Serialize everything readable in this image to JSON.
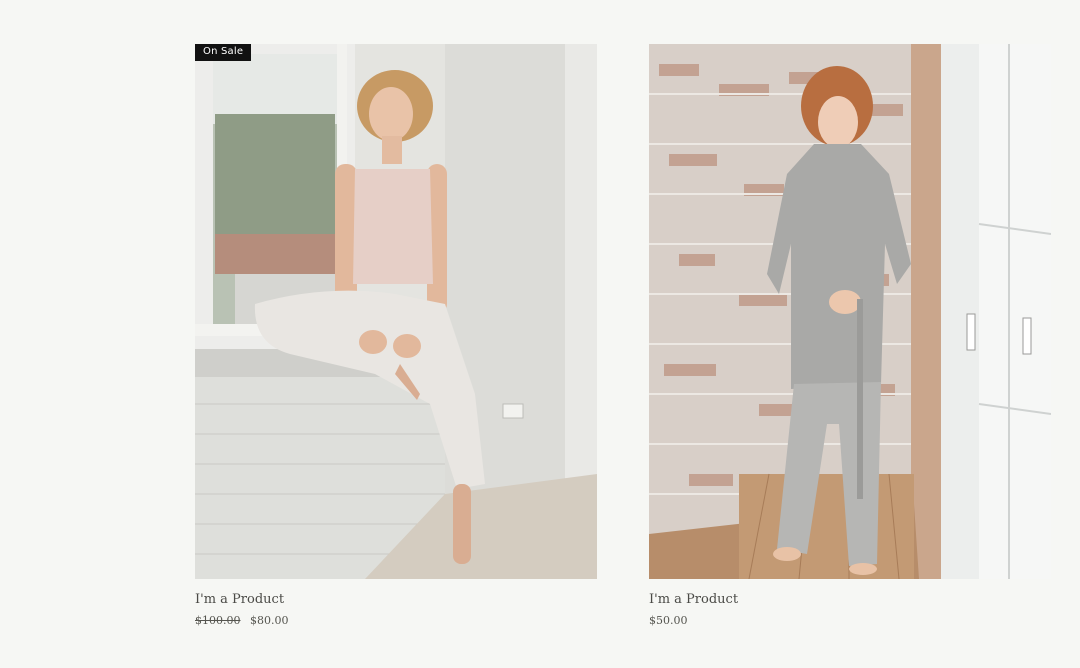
{
  "products": [
    {
      "badge": "On Sale",
      "name": "I'm a Product",
      "old_price": "$100.00",
      "price": "$80.00"
    },
    {
      "name": "I'm a Product",
      "price": "$50.00"
    }
  ],
  "colors": {
    "page_background": "#f6f7f4",
    "badge_background": "#111111",
    "text": "#4a4a46"
  }
}
